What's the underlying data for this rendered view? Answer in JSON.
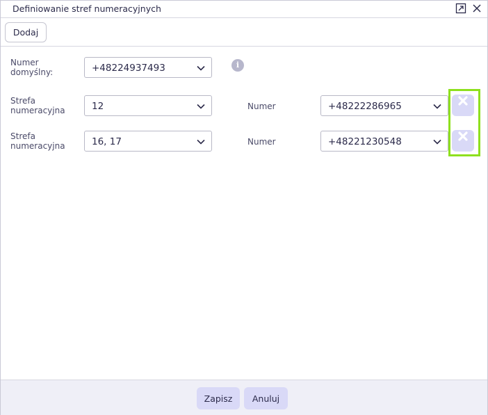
{
  "window": {
    "title": "Definiowanie stref numeracyjnych",
    "popout_icon": "popout-icon",
    "close_icon": "close-icon"
  },
  "toolbar": {
    "add_label": "Dodaj"
  },
  "default_number": {
    "label_line1": "Numer",
    "label_line2": "domyślny:",
    "value": "+48224937493",
    "info_icon": "info-icon"
  },
  "zones": [
    {
      "zone_label_line1": "Strefa",
      "zone_label_line2": "numeracyjna",
      "zone_value": "12",
      "number_label": "Numer",
      "number_value": "+48222286965",
      "delete_icon": "close-icon"
    },
    {
      "zone_label_line1": "Strefa",
      "zone_label_line2": "numeracyjna",
      "zone_value": "16, 17",
      "number_label": "Numer",
      "number_value": "+48221230548",
      "delete_icon": "close-icon"
    }
  ],
  "footer": {
    "save_label": "Zapisz",
    "cancel_label": "Anuluj"
  },
  "colors": {
    "highlight": "#8ee01e",
    "button_bg": "#d9d9f7",
    "footer_bg": "#efeff7"
  }
}
